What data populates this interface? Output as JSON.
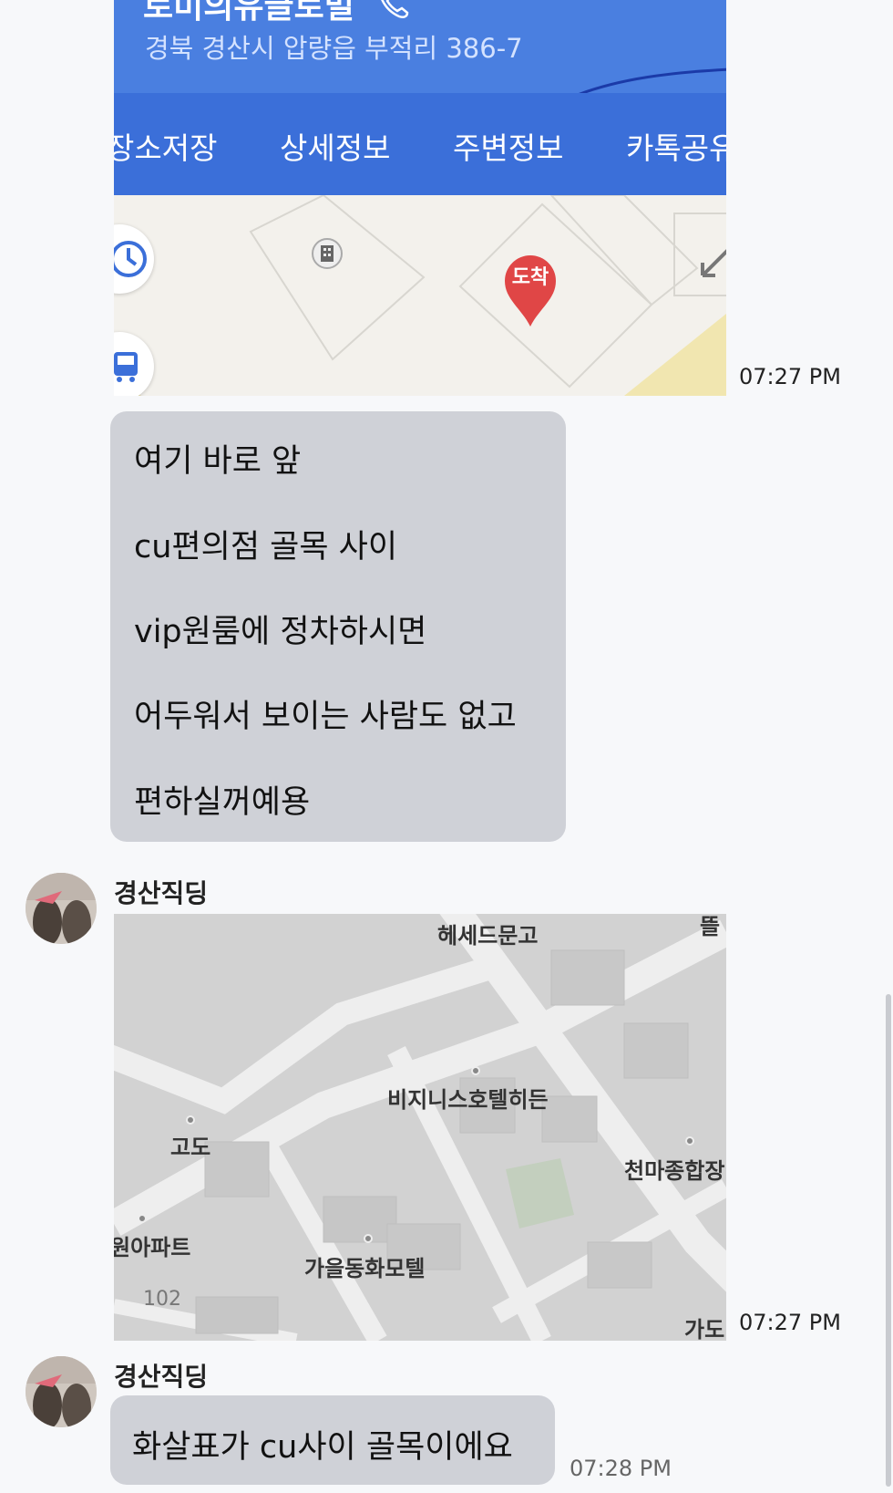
{
  "message_1": {
    "place_title": "로미의유글로벌",
    "address": "경북 경산시 압량읍 부적리 386-7",
    "tabs": [
      "장소저장",
      "상세정보",
      "주변정보",
      "카톡공유"
    ],
    "destination_pin": "도착",
    "icons": [
      "phone-icon",
      "clock-icon",
      "bus-icon",
      "building-icon",
      "arrow-icon"
    ],
    "time": "07:27 PM"
  },
  "message_2": {
    "lines": [
      "여기 바로 앞",
      "cu편의점 골목 사이",
      "vip원룸에 정차하시면",
      "어두워서 보이는 사람도 없고",
      "편하실꺼예용"
    ]
  },
  "message_3": {
    "sender": "경산직딩",
    "map_labels": {
      "hesed": "헤세드문고",
      "top_right": "뜰",
      "business_hotel": "비지니스호텔히든",
      "godo": "고도",
      "cheonma": "천마종합장",
      "apartment": "원아파트",
      "motel": "가을동화모텔",
      "number": "102",
      "bottom_right": "가도"
    },
    "time": "07:27 PM"
  },
  "message_4": {
    "sender": "경산직딩",
    "text": "화살표가 cu사이 골목이에요",
    "time": "07:28 PM"
  }
}
